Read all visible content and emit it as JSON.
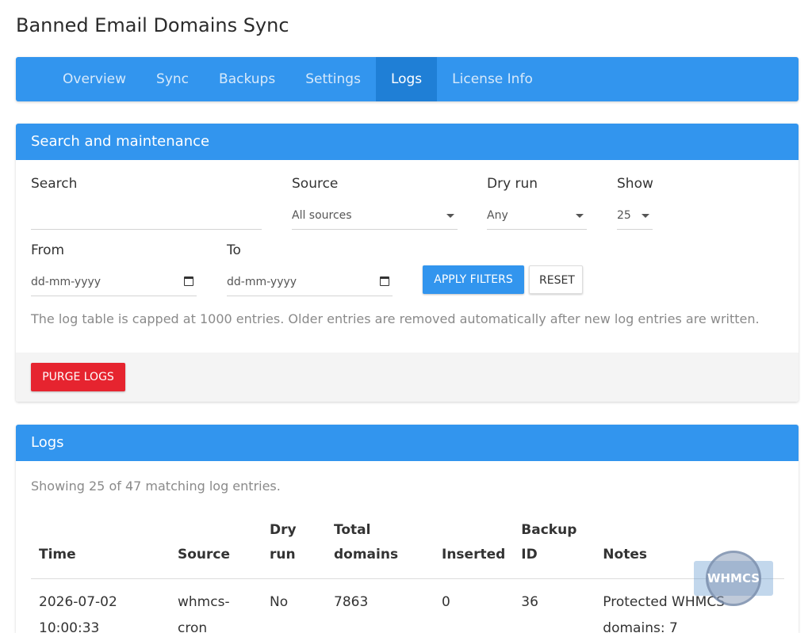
{
  "page": {
    "title": "Banned Email Domains Sync"
  },
  "tabs": [
    {
      "label": "Overview"
    },
    {
      "label": "Sync"
    },
    {
      "label": "Backups"
    },
    {
      "label": "Settings"
    },
    {
      "label": "Logs"
    },
    {
      "label": "License Info"
    }
  ],
  "active_tab": "Logs",
  "search_card": {
    "title": "Search and maintenance",
    "search": {
      "label": "Search",
      "value": ""
    },
    "source": {
      "label": "Source",
      "value": "All sources"
    },
    "dry_run": {
      "label": "Dry run",
      "value": "Any"
    },
    "show": {
      "label": "Show",
      "value": "25"
    },
    "from": {
      "label": "From",
      "placeholder": "dd-mm-yyyy"
    },
    "to": {
      "label": "To",
      "placeholder": "dd-mm-yyyy"
    },
    "apply_label": "APPLY FILTERS",
    "reset_label": "RESET",
    "note": "The log table is capped at 1000 entries. Older entries are removed automatically after new log entries are written.",
    "purge_label": "PURGE LOGS"
  },
  "logs_card": {
    "title": "Logs",
    "showing": "Showing 25 of 47 matching log entries.",
    "columns": {
      "time": "Time",
      "source": "Source",
      "dry_run": "Dry run",
      "total_domains": "Total domains",
      "inserted": "Inserted",
      "backup_id": "Backup ID",
      "notes": "Notes"
    },
    "rows": [
      {
        "time": "2026-07-02 10:00:33",
        "source": "whmcs-cron",
        "dry_run": "No",
        "total_domains": "7863",
        "inserted": "0",
        "backup_id": "36",
        "notes": "Protected WHMCS domains: 7"
      }
    ]
  },
  "watermark": {
    "text": "WHMCS"
  },
  "colors": {
    "primary": "#3295ee",
    "active_tab": "#1f7fd6",
    "danger": "#e6242f"
  }
}
